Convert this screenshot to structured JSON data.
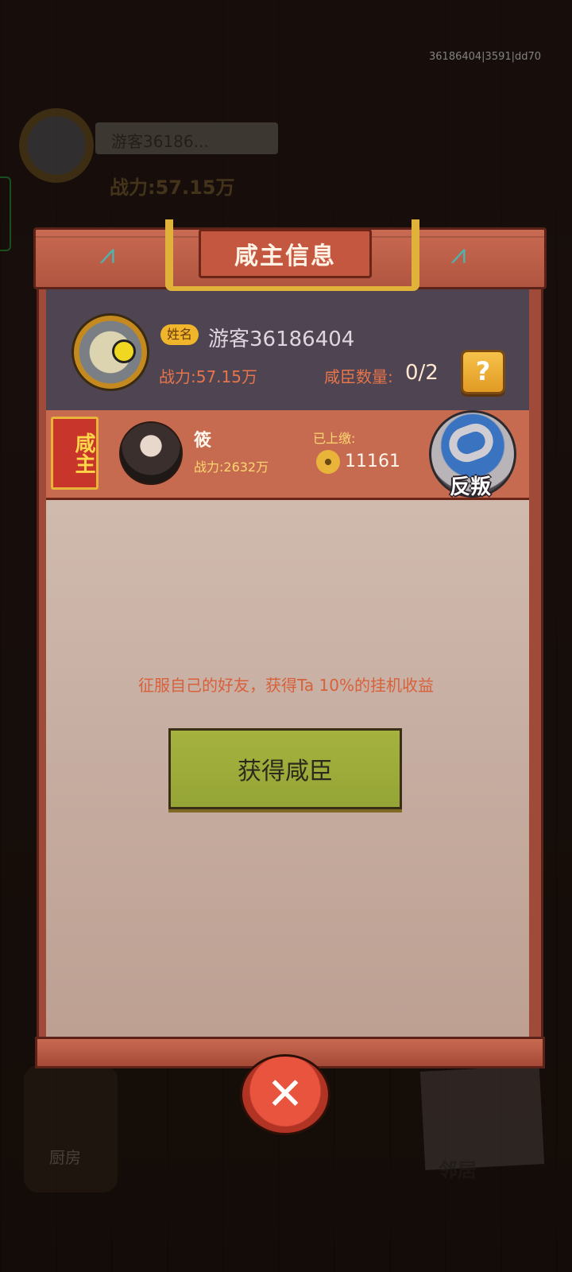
{
  "session_id": "36186404|3591|dd70",
  "background": {
    "player_name": "游客36186...",
    "player_power": "战力:57.15万",
    "kitchen_label": "厨房",
    "neighbor_label": "邻居"
  },
  "dialog": {
    "title": "咸主信息",
    "name_tag": "姓名",
    "player_name": "游客36186404",
    "power": "战力:57.15万",
    "vassal_label": "咸臣数量:",
    "vassal_count": "0/2",
    "help_icon": "?",
    "lord": {
      "badge": "咸主",
      "name": "筱",
      "power": "战力:2632万",
      "paid_label": "已上缴:",
      "paid_value": "11161",
      "revolt_label": "反叛"
    },
    "hint": "征服自己的好友，获得Ta 10%的挂机收益",
    "get_vassal_button": "获得咸臣",
    "close_icon": "✕"
  },
  "colors": {
    "accent_orange": "#e8744a",
    "gold": "#f1b52b",
    "button_green": "#a5b23e",
    "close_red": "#e8543e"
  }
}
